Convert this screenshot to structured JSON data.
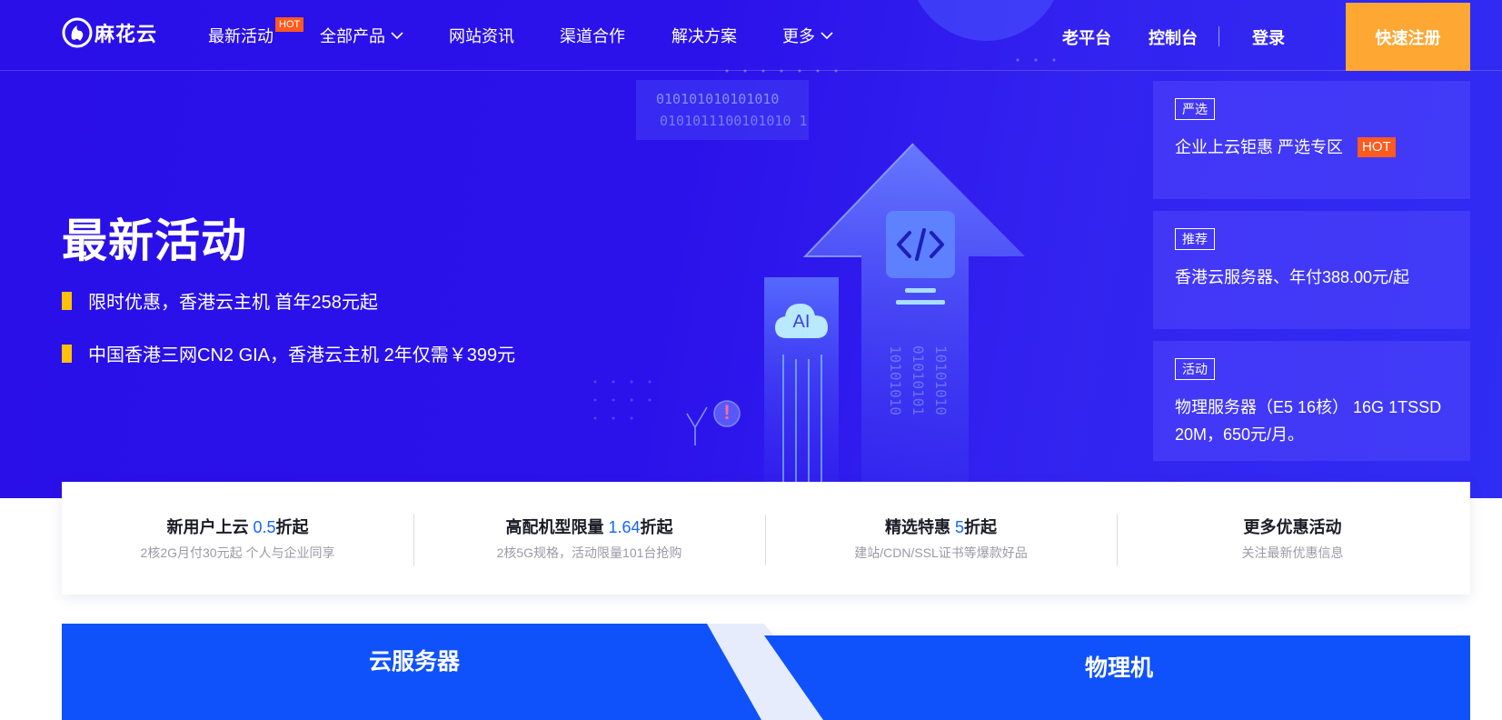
{
  "nav": {
    "logo_text": "麻花云",
    "items": [
      {
        "label": "最新活动",
        "has_hot": true
      },
      {
        "label": "全部产品",
        "has_chevron": true
      },
      {
        "label": "网站资讯"
      },
      {
        "label": "渠道合作"
      },
      {
        "label": "解决方案"
      },
      {
        "label": "更多",
        "has_chevron": true
      }
    ],
    "hot_label": "HOT",
    "right": {
      "old_platform": "老平台",
      "console": "控制台",
      "login": "登录",
      "register": "快速注册"
    }
  },
  "hero": {
    "title": "最新活动",
    "bullets": [
      "限时优惠，香港云主机 首年258元起",
      "中国香港三网CN2 GIA，香港云主机 2年仅需￥399元"
    ],
    "illustration": {
      "binary_line1": "010101010101010",
      "binary_line2": "0101011100101010 1",
      "ai_label": "AI",
      "code_icon": "code-brackets-icon",
      "alert_icon": "exclamation-icon"
    }
  },
  "promos": [
    {
      "tag": "严选",
      "text": "企业上云钜惠 严选专区",
      "hot": "HOT"
    },
    {
      "tag": "推荐",
      "text": "香港云服务器、年付388.00元/起"
    },
    {
      "tag": "活动",
      "text": "物理服务器（E5 16核） 16G 1TSSD 20M，650元/月。"
    }
  ],
  "benefits": [
    {
      "title_pre": "新用户上云 ",
      "highlight": "0.5",
      "title_post": "折起",
      "sub": "2核2G月付30元起 个人与企业同享"
    },
    {
      "title_pre": "高配机型限量 ",
      "highlight": "1.64",
      "title_post": "折起",
      "sub": "2核5G规格，活动限量101台抢购"
    },
    {
      "title_pre": "精选特惠 ",
      "highlight": "5",
      "title_post": "折起",
      "sub": "建站/CDN/SSL证书等爆款好品"
    },
    {
      "title_pre": "更多优惠活动",
      "highlight": "",
      "title_post": "",
      "sub": "关注最新优惠信息"
    }
  ],
  "tabs": [
    "云服务器",
    "物理机"
  ],
  "colors": {
    "hero_bg": "#2a0fe8",
    "accent_orange": "#ffa733",
    "hot_red": "#ff5a1f",
    "bullet_yellow": "#ffc107",
    "tab_blue": "#0f52fb",
    "highlight_blue": "#1565ff"
  }
}
